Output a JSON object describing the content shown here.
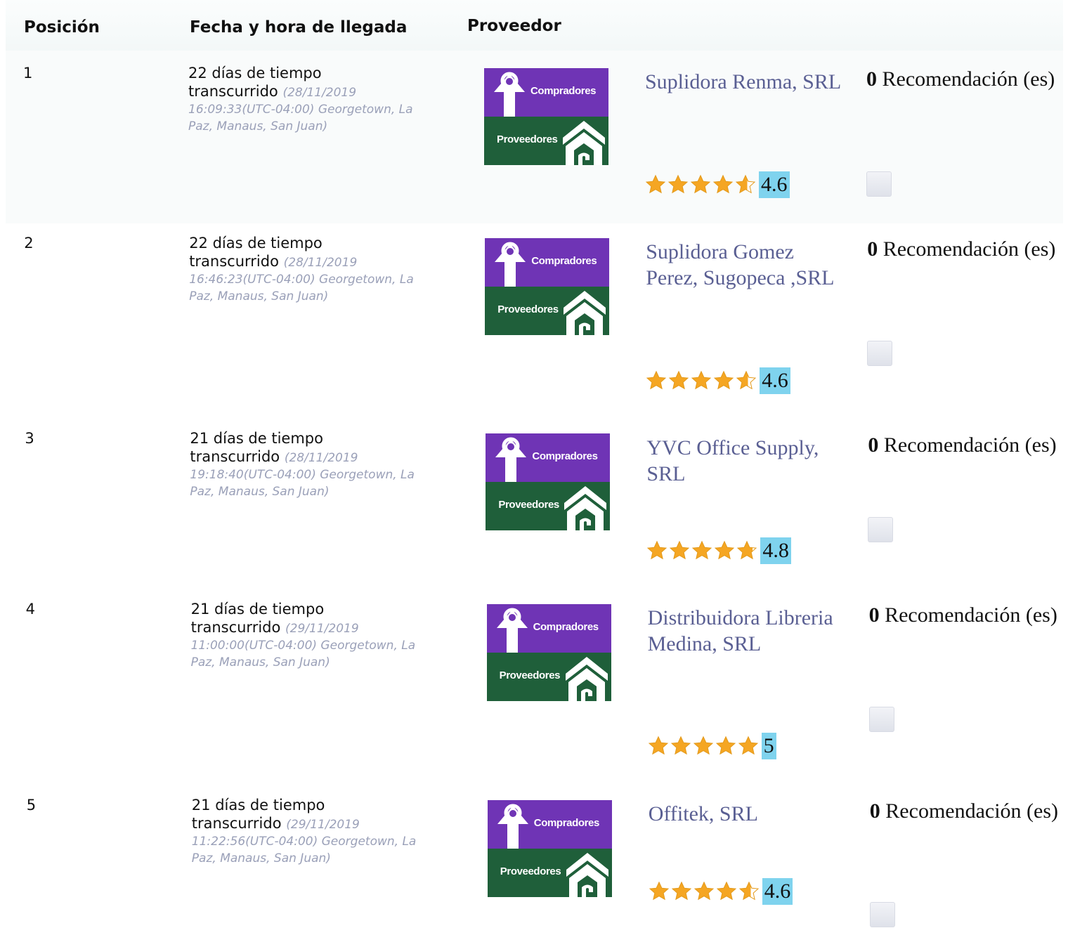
{
  "header": {
    "position": "Posición",
    "arrival": "Fecha y hora de llegada",
    "provider": "Proveedor"
  },
  "logo": {
    "top_text": "Compradores",
    "bottom_text": "Proveedores"
  },
  "rows": [
    {
      "position": "1",
      "elapsed_line1": "22 días de tiempo",
      "elapsed_line2": "transcurrido",
      "date": "(28/11/2019",
      "time_zone": "16:09:33(UTC-04:00) Georgetown, La Paz, Manaus, San Juan)",
      "name": "Suplidora Renma, SRL",
      "rating": 4.6,
      "score": "4.6",
      "rec_count": "0",
      "rec_label": "Recomendación (es)"
    },
    {
      "position": "2",
      "elapsed_line1": "22 días de tiempo",
      "elapsed_line2": "transcurrido",
      "date": "(28/11/2019",
      "time_zone": "16:46:23(UTC-04:00) Georgetown, La Paz, Manaus, San Juan)",
      "name": "Suplidora Gomez Perez, Sugopeca ,SRL",
      "rating": 4.6,
      "score": "4.6",
      "rec_count": "0",
      "rec_label": "Recomendación (es)"
    },
    {
      "position": "3",
      "elapsed_line1": "21 días de tiempo",
      "elapsed_line2": "transcurrido",
      "date": "(28/11/2019",
      "time_zone": "19:18:40(UTC-04:00) Georgetown, La Paz, Manaus, San Juan)",
      "name": "YVC Office Supply, SRL",
      "rating": 4.8,
      "score": "4.8",
      "rec_count": "0",
      "rec_label": "Recomendación (es)"
    },
    {
      "position": "4",
      "elapsed_line1": "21 días de tiempo",
      "elapsed_line2": "transcurrido",
      "date": "(29/11/2019",
      "time_zone": "11:00:00(UTC-04:00) Georgetown, La Paz, Manaus, San Juan)",
      "name": "Distribuidora Libreria Medina, SRL",
      "rating": 5,
      "score": "5",
      "rec_count": "0",
      "rec_label": "Recomendación (es)"
    },
    {
      "position": "5",
      "elapsed_line1": "21 días de tiempo",
      "elapsed_line2": "transcurrido",
      "date": "(29/11/2019",
      "time_zone": "11:22:56(UTC-04:00) Georgetown, La Paz, Manaus, San Juan)",
      "name": "Offitek, SRL",
      "rating": 4.6,
      "score": "4.6",
      "rec_count": "0",
      "rec_label": "Recomendación (es)"
    }
  ],
  "colors": {
    "logo_purple": "#6f34b5",
    "logo_green": "#1f5f3a",
    "name_text": "#5a5f93",
    "score_bg": "#7fd3ee",
    "star": "#f5a623"
  }
}
